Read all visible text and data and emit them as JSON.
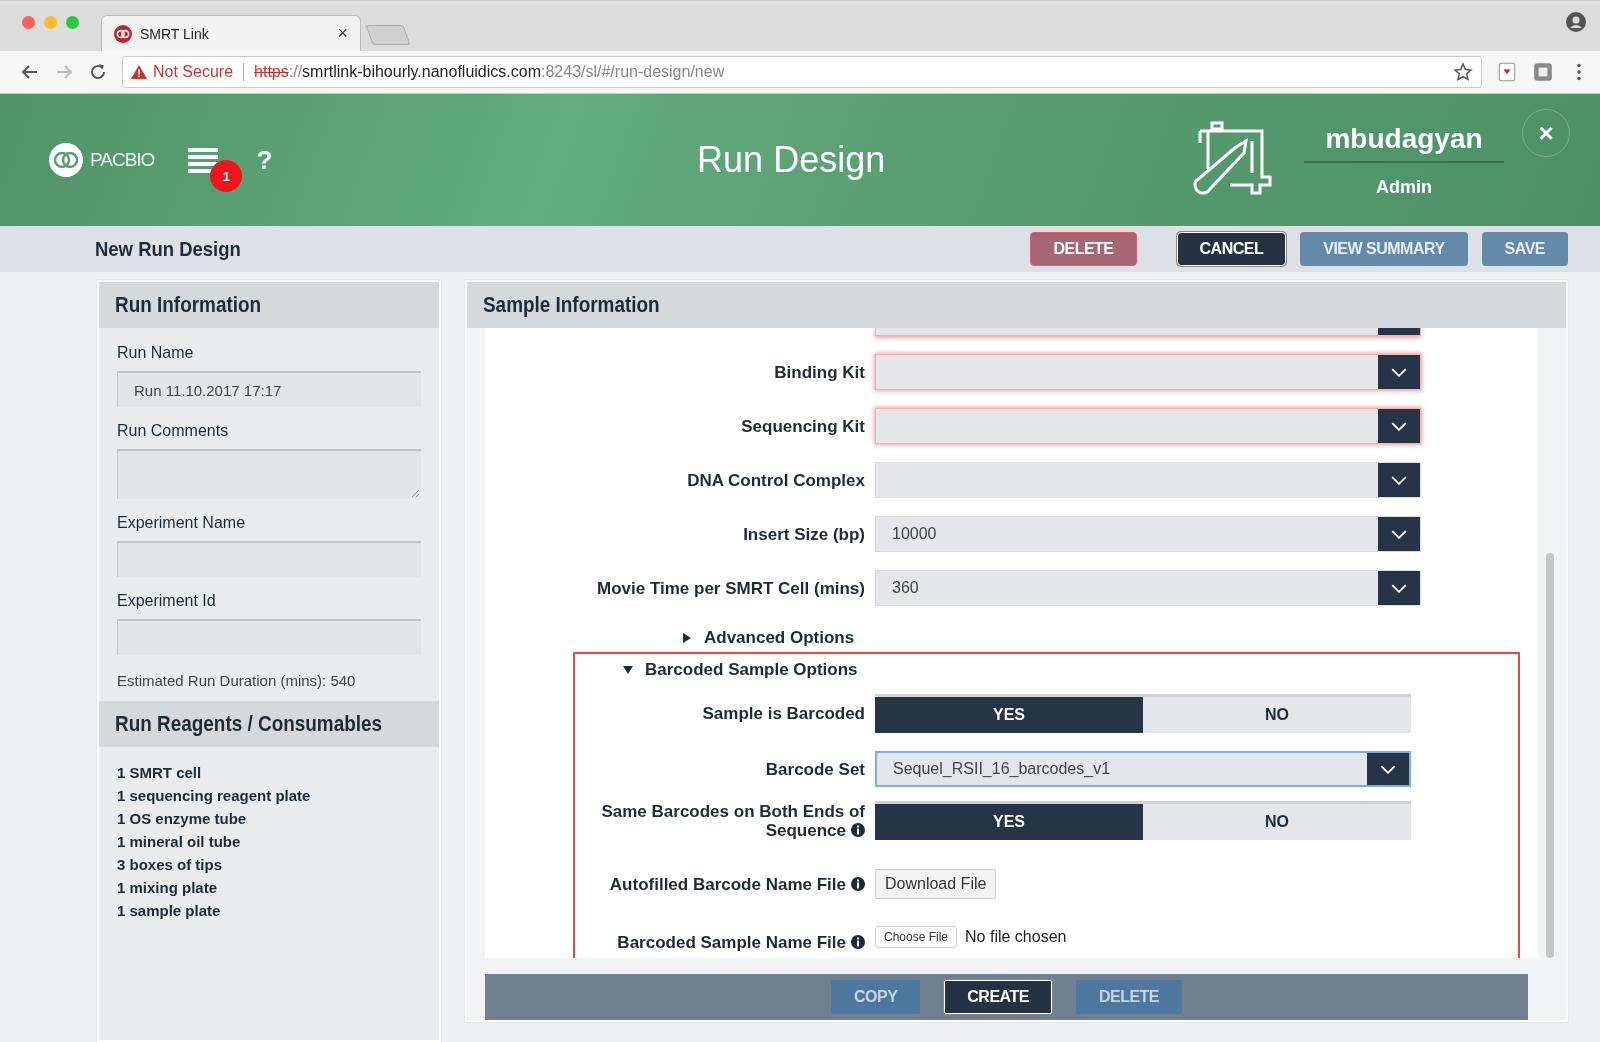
{
  "browser": {
    "tab_title": "SMRT Link",
    "tab_close": "×",
    "address": {
      "security": "Not Secure",
      "scheme": "https",
      "separator": "://",
      "host": "smrtlink-bihourly.nanofluidics.com",
      "path": ":8243/sl/#/run-design/new"
    }
  },
  "header": {
    "logo": "PACBIO",
    "notification_count": "1",
    "help": "?",
    "title": "Run Design",
    "user": "mbudagyan",
    "role": "Admin",
    "close": "×"
  },
  "toolbar": {
    "title": "New Run Design",
    "buttons": [
      {
        "label": "DELETE",
        "kind": "danger"
      },
      {
        "label": "CANCEL",
        "kind": "dark"
      },
      {
        "label": "VIEW SUMMARY",
        "kind": "muted"
      },
      {
        "label": "SAVE",
        "kind": "muted"
      }
    ]
  },
  "run_information": {
    "title": "Run Information",
    "fields": [
      {
        "label": "Run Name",
        "kind": "input",
        "value": "Run 11.10.2017 17:17"
      },
      {
        "label": "Run Comments",
        "kind": "textarea"
      },
      {
        "label": "Experiment Name",
        "kind": "input"
      },
      {
        "label": "Experiment Id",
        "kind": "input"
      }
    ],
    "estimate": "Estimated Run Duration (mins): 540"
  },
  "reagents": {
    "title": "Run Reagents / Consumables",
    "items": [
      "1 SMRT cell",
      "1 sequencing reagent plate",
      "1 OS enzyme tube",
      "1 mineral oil tube",
      "3 boxes of tips",
      "1 mixing plate",
      "1 sample plate"
    ]
  },
  "sample_information": {
    "title": "Sample Information",
    "rows": [
      {
        "kind": "cut",
        "invalid": true
      },
      {
        "kind": "select",
        "label": "Binding Kit",
        "invalid": true
      },
      {
        "kind": "select",
        "label": "Sequencing Kit",
        "invalid": true
      },
      {
        "kind": "select",
        "label": "DNA Control Complex",
        "invalid": false
      },
      {
        "kind": "select",
        "label": "Insert Size (bp)",
        "value": "10000",
        "invalid": false
      },
      {
        "kind": "select",
        "label": "Movie Time per SMRT Cell (mins)",
        "value": "360",
        "invalid": false
      }
    ],
    "advanced_options": {
      "label": "Advanced Options",
      "expanded": false
    },
    "barcoded_options": {
      "label": "Barcoded Sample Options",
      "expanded": true,
      "highlighted": true,
      "rows": [
        {
          "kind": "toggle",
          "label": "Sample is Barcoded",
          "info": false,
          "options": [
            {
              "label": "YES",
              "selected": true
            },
            {
              "label": "NO",
              "selected": false
            }
          ]
        },
        {
          "kind": "select",
          "label": "Barcode Set",
          "info": false,
          "value": "Sequel_RSII_16_barcodes_v1",
          "focused": true
        },
        {
          "kind": "toggle",
          "label": "Same Barcodes on Both Ends of Sequence",
          "info": true,
          "options": [
            {
              "label": "YES",
              "selected": true
            },
            {
              "label": "NO",
              "selected": false
            }
          ]
        },
        {
          "kind": "download",
          "label": "Autofilled Barcode Name File",
          "info": true,
          "button": "Download File"
        },
        {
          "kind": "file",
          "label": "Barcoded Sample Name File",
          "info": true,
          "button": "Choose File",
          "status": "No file chosen"
        }
      ]
    },
    "footer_buttons": [
      {
        "label": "COPY",
        "kind": "muted"
      },
      {
        "label": "CREATE",
        "kind": "dark"
      },
      {
        "label": "DELETE",
        "kind": "muted"
      }
    ]
  }
}
